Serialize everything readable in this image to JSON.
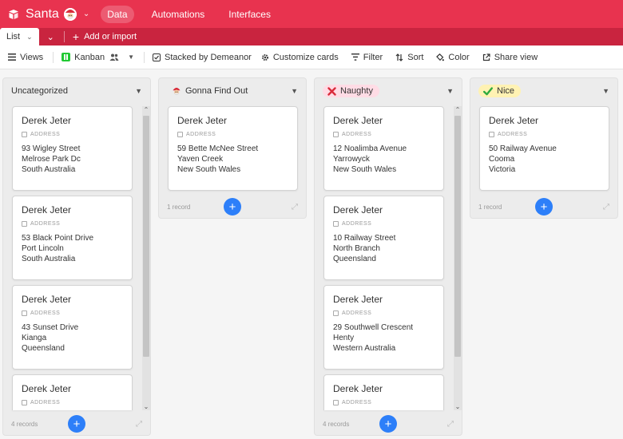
{
  "app": {
    "base_name": "Santa",
    "tabs": [
      "Data",
      "Automations",
      "Interfaces"
    ],
    "brand_color": "#e8334f"
  },
  "viewbar": {
    "view_name": "List",
    "add_import": "Add or import"
  },
  "toolbar": {
    "views": "Views",
    "kanban": "Kanban",
    "stacked_by": "Stacked by Demeanor",
    "customize": "Customize cards",
    "filter": "Filter",
    "sort": "Sort",
    "color": "Color",
    "share": "Share view"
  },
  "address_label": "ADDRESS",
  "stacks": [
    {
      "title": "Uncategorized",
      "record_count": "4 records",
      "cards": [
        {
          "name": "Derek Jeter",
          "address": [
            "93 Wigley Street",
            "Melrose Park Dc",
            "South Australia"
          ]
        },
        {
          "name": "Derek Jeter",
          "address": [
            "53 Black Point Drive",
            "Port Lincoln",
            "South Australia"
          ]
        },
        {
          "name": "Derek Jeter",
          "address": [
            "43 Sunset Drive",
            "Kianga",
            "Queensland"
          ]
        },
        {
          "name": "Derek Jeter",
          "address": []
        }
      ]
    },
    {
      "title": "Gonna Find Out",
      "icon": "santa-face-icon",
      "record_count": "1 record",
      "cards": [
        {
          "name": "Derek Jeter",
          "address": [
            "59 Bette McNee Street",
            "Yaven Creek",
            "New South Wales"
          ]
        }
      ]
    },
    {
      "title": "Naughty",
      "icon": "red-x-icon",
      "pill_color": "#ffdce5",
      "record_count": "4 records",
      "cards": [
        {
          "name": "Derek Jeter",
          "address": [
            "12 Noalimba Avenue",
            "Yarrowyck",
            "New South Wales"
          ]
        },
        {
          "name": "Derek Jeter",
          "address": [
            "10 Railway Street",
            "North Branch",
            "Queensland"
          ]
        },
        {
          "name": "Derek Jeter",
          "address": [
            "29 Southwell Crescent",
            "Henty",
            "Western Australia"
          ]
        },
        {
          "name": "Derek Jeter",
          "address": []
        }
      ]
    },
    {
      "title": "Nice",
      "icon": "green-check-icon",
      "pill_color": "#fff2b3",
      "record_count": "1 record",
      "cards": [
        {
          "name": "Derek Jeter",
          "address": [
            "50 Railway Avenue",
            "Cooma",
            "Victoria"
          ]
        }
      ]
    }
  ]
}
